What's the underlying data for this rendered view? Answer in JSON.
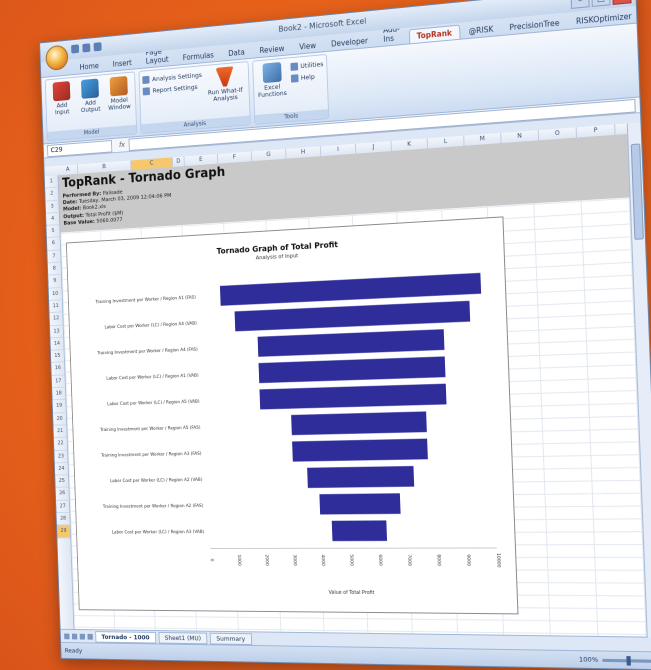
{
  "window": {
    "title": "Book2 - Microsoft Excel"
  },
  "ribbon": {
    "tabs": [
      "Home",
      "Insert",
      "Page Layout",
      "Formulas",
      "Data",
      "Review",
      "View",
      "Developer",
      "Add-Ins",
      "TopRank",
      "@RISK",
      "PrecisionTree",
      "RISKOptimizer"
    ],
    "active_tab": "TopRank",
    "groups": [
      {
        "label": "Model",
        "buttons": [
          "Add Input",
          "Add Output",
          "Model Window"
        ]
      },
      {
        "label": "Analysis",
        "buttons": [
          "Analysis Settings",
          "Report Settings",
          "Run What-If Analysis"
        ]
      },
      {
        "label": "Tools",
        "buttons": [
          "Excel Functions",
          "Utilities",
          "Help"
        ]
      }
    ]
  },
  "formula_bar": {
    "name_box": "C29",
    "fx": "fx"
  },
  "sheet": {
    "column_headers": [
      "A",
      "B",
      "C",
      "D",
      "E",
      "F",
      "G",
      "H",
      "I",
      "J",
      "K",
      "L",
      "M",
      "N",
      "O",
      "P"
    ],
    "row_count": 28,
    "selected_row": "29",
    "report": {
      "title": "TopRank - Tornado Graph",
      "meta": [
        {
          "label": "Performed By:",
          "value": "Palisade"
        },
        {
          "label": "Date:",
          "value": "Tuesday, March 03, 2009 12:04:06 PM"
        },
        {
          "label": "Model:",
          "value": "Book2.xls"
        },
        {
          "label": "Output:",
          "value": "Total Profit ($M)"
        },
        {
          "label": "Base Value:",
          "value": "5060.0077"
        }
      ]
    }
  },
  "chart_data": {
    "type": "bar",
    "title": "Tornado Graph of Total Profit",
    "subtitle": "Analysis of Input",
    "xlabel": "Value of Total Profit",
    "orientation": "horizontal-tornado",
    "base_value": 5060,
    "xlim": [
      0,
      10000
    ],
    "xticks": [
      "0",
      "1000",
      "2000",
      "3000",
      "4000",
      "5000",
      "6000",
      "7000",
      "8000",
      "9000",
      "10000"
    ],
    "categories": [
      "Training Investment per Worker / Region A1 (FAS)",
      "Labor Cost per Worker (LC) / Region A4 (VAB)",
      "Training Investment per Worker / Region A4 (FAS)",
      "Labor Cost per Worker (LC) / Region A1 (VAB)",
      "Labor Cost per Worker (LC) / Region A5 (VAB)",
      "Training Investment per Worker / Region A5 (FAS)",
      "Training Investment per Worker / Region A3 (FAS)",
      "Labor Cost per Worker (LC) / Region A2 (VAB)",
      "Training Investment per Worker / Region A2 (FAS)",
      "Labor Cost per Worker (LC) / Region A3 (VAB)"
    ],
    "low": [
      700,
      1200,
      2000,
      2000,
      2000,
      3100,
      3100,
      3600,
      4000,
      4400
    ],
    "high": [
      9800,
      9400,
      8500,
      8500,
      8500,
      7800,
      7800,
      7300,
      6800,
      6300
    ],
    "bar_color": "#2e2d9a"
  },
  "sheet_tabs": [
    "Tornado - 1000",
    "Sheet1 (MU)",
    "Summary"
  ],
  "status": {
    "text": "Ready",
    "zoom": "100%"
  },
  "colors": {
    "background": "#e8621a",
    "bar": "#2e2d9a",
    "header_fill": "#c9c9c9"
  }
}
